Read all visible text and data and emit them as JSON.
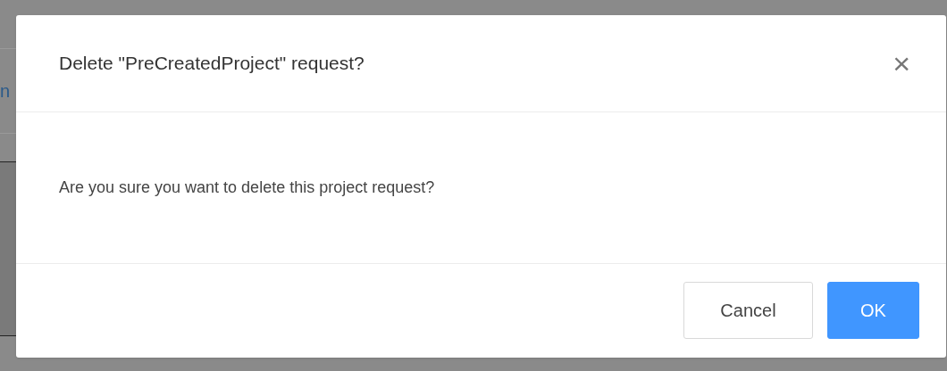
{
  "background": {
    "text_fragment": "n"
  },
  "dialog": {
    "title": "Delete \"PreCreatedProject\" request?",
    "close": "×",
    "message": "Are you sure you want to delete this project request?",
    "buttons": [
      {
        "label": "Cancel",
        "kind": "secondary"
      },
      {
        "label": "OK",
        "kind": "primary"
      }
    ]
  }
}
